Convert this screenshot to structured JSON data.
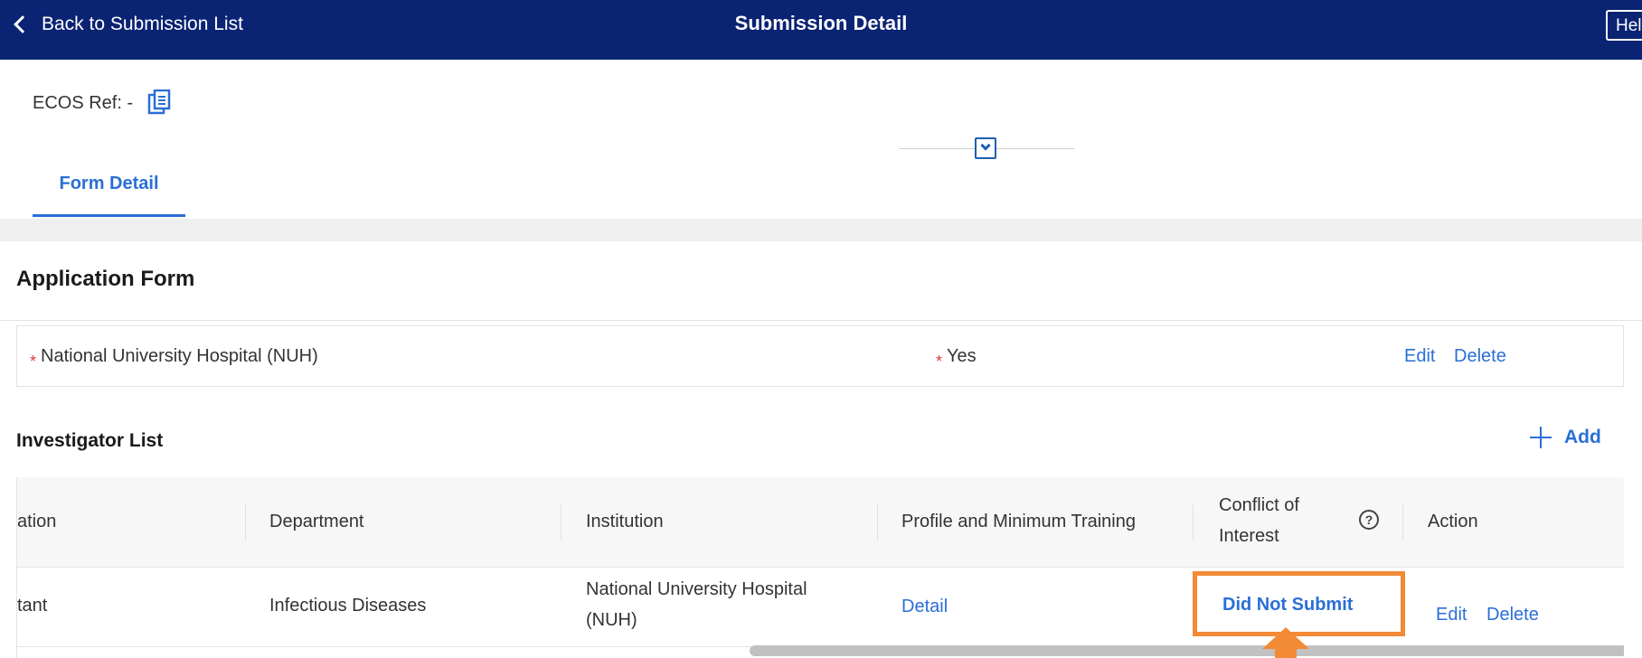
{
  "header": {
    "back_label": "Back to Submission List",
    "title": "Submission Detail",
    "help_label": "Hel"
  },
  "ref": {
    "label": "ECOS Ref: -",
    "copy_icon": "copy-icon"
  },
  "tabs": [
    {
      "label": "Form Detail",
      "active": true
    }
  ],
  "section": {
    "title": "Application Form"
  },
  "institution_row": {
    "required_mark": "*",
    "institution": "National University Hospital (NUH)",
    "answer": "Yes",
    "edit_label": "Edit",
    "delete_label": "Delete"
  },
  "investigators": {
    "title": "Investigator List",
    "add_label": "Add",
    "columns": [
      "ation",
      "Department",
      "Institution",
      "Profile and Minimum Training",
      "Conflict of Interest",
      "Action"
    ],
    "conflict_line1": "Conflict of",
    "conflict_line2": "Interest",
    "rows": [
      {
        "designation": "tant",
        "department": "Infectious Diseases",
        "institution_line1": "National University Hospital",
        "institution_line2": "(NUH)",
        "profile_link": "Detail",
        "conflict_status": "Did Not Submit",
        "edit_label": "Edit",
        "delete_label": "Delete"
      }
    ]
  },
  "colors": {
    "header_bg": "#0a2373",
    "link": "#2a6fd6",
    "highlight": "#f28a36",
    "required": "#e03a3a"
  }
}
